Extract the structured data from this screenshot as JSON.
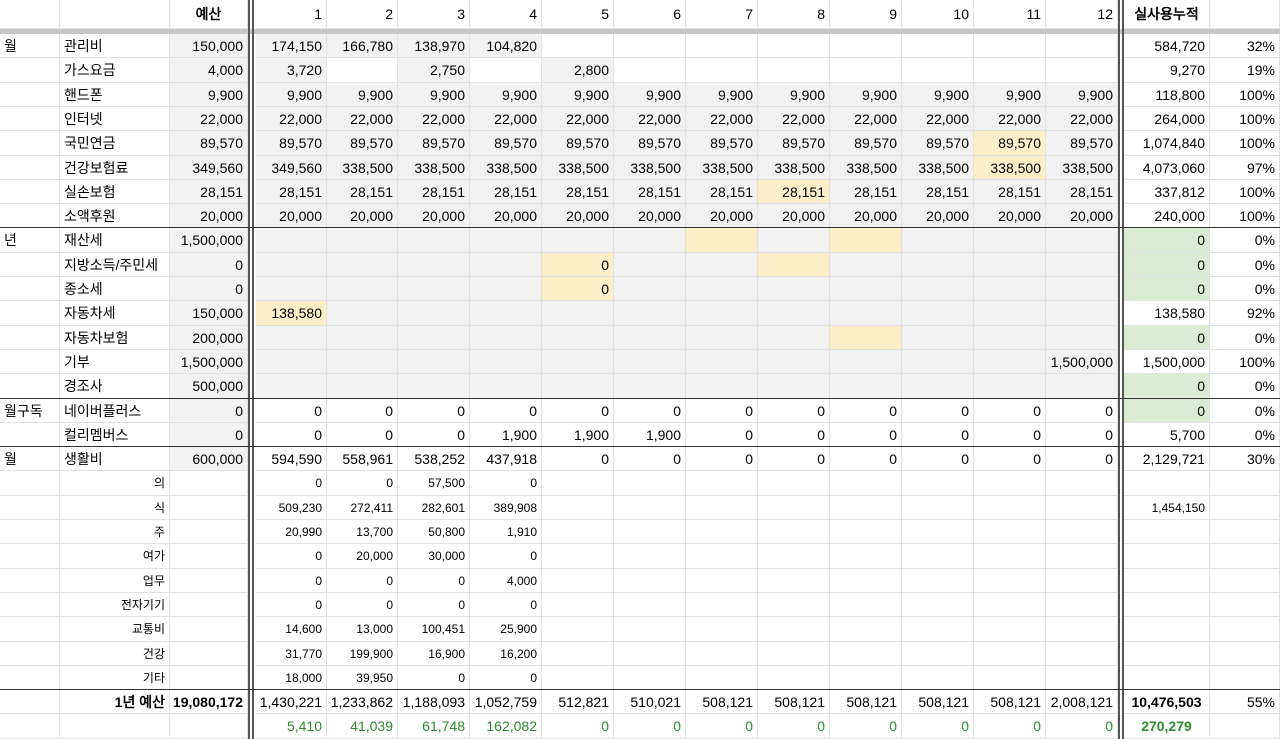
{
  "header": {
    "budget_label": "예산",
    "months": [
      "1",
      "2",
      "3",
      "4",
      "5",
      "6",
      "7",
      "8",
      "9",
      "10",
      "11",
      "12"
    ],
    "total_label": "실사용누적"
  },
  "groups": [
    "월",
    "년",
    "월구독",
    "월"
  ],
  "rows": [
    {
      "category": "월",
      "label": "관리비",
      "budget": "150,000",
      "months": [
        "174,150",
        "166,780",
        "138,970",
        "104,820",
        "",
        "",
        "",
        "",
        "",
        "",
        "",
        ""
      ],
      "total": "584,720",
      "pct": "32%"
    },
    {
      "category": "",
      "label": "가스요금",
      "budget": "4,000",
      "months": [
        "3,720",
        "",
        "2,750",
        "",
        "2,800",
        "",
        "",
        "",
        "",
        "",
        "",
        ""
      ],
      "total": "9,270",
      "pct": "19%"
    },
    {
      "category": "",
      "label": "핸드폰",
      "budget": "9,900",
      "months": [
        "9,900",
        "9,900",
        "9,900",
        "9,900",
        "9,900",
        "9,900",
        "9,900",
        "9,900",
        "9,900",
        "9,900",
        "9,900",
        "9,900"
      ],
      "total": "118,800",
      "pct": "100%"
    },
    {
      "category": "",
      "label": "인터넷",
      "budget": "22,000",
      "months": [
        "22,000",
        "22,000",
        "22,000",
        "22,000",
        "22,000",
        "22,000",
        "22,000",
        "22,000",
        "22,000",
        "22,000",
        "22,000",
        "22,000"
      ],
      "total": "264,000",
      "pct": "100%"
    },
    {
      "category": "",
      "label": "국민연금",
      "budget": "89,570",
      "months": [
        "89,570",
        "89,570",
        "89,570",
        "89,570",
        "89,570",
        "89,570",
        "89,570",
        "89,570",
        "89,570",
        "89,570",
        "89,570",
        "89,570"
      ],
      "total": "1,074,840",
      "pct": "100%"
    },
    {
      "category": "",
      "label": "건강보험료",
      "budget": "349,560",
      "months": [
        "349,560",
        "338,500",
        "338,500",
        "338,500",
        "338,500",
        "338,500",
        "338,500",
        "338,500",
        "338,500",
        "338,500",
        "338,500",
        "338,500"
      ],
      "total": "4,073,060",
      "pct": "97%"
    },
    {
      "category": "",
      "label": "실손보험",
      "budget": "28,151",
      "months": [
        "28,151",
        "28,151",
        "28,151",
        "28,151",
        "28,151",
        "28,151",
        "28,151",
        "28,151",
        "28,151",
        "28,151",
        "28,151",
        "28,151"
      ],
      "total": "337,812",
      "pct": "100%"
    },
    {
      "category": "",
      "label": "소액후원",
      "budget": "20,000",
      "months": [
        "20,000",
        "20,000",
        "20,000",
        "20,000",
        "20,000",
        "20,000",
        "20,000",
        "20,000",
        "20,000",
        "20,000",
        "20,000",
        "20,000"
      ],
      "total": "240,000",
      "pct": "100%"
    },
    {
      "category": "년",
      "label": "재산세",
      "budget": "1,500,000",
      "months": [
        "",
        "",
        "",
        "",
        "",
        "",
        "",
        "",
        "",
        "",
        "",
        ""
      ],
      "total": "0",
      "pct": "0%"
    },
    {
      "category": "",
      "label": "지방소득/주민세",
      "budget": "0",
      "months": [
        "",
        "",
        "",
        "",
        "0",
        "",
        "",
        "",
        "",
        "",
        "",
        ""
      ],
      "total": "0",
      "pct": "0%"
    },
    {
      "category": "",
      "label": "종소세",
      "budget": "0",
      "months": [
        "",
        "",
        "",
        "",
        "0",
        "",
        "",
        "",
        "",
        "",
        "",
        ""
      ],
      "total": "0",
      "pct": "0%"
    },
    {
      "category": "",
      "label": "자동차세",
      "budget": "150,000",
      "months": [
        "138,580",
        "",
        "",
        "",
        "",
        "",
        "",
        "",
        "",
        "",
        "",
        ""
      ],
      "total": "138,580",
      "pct": "92%"
    },
    {
      "category": "",
      "label": "자동차보험",
      "budget": "200,000",
      "months": [
        "",
        "",
        "",
        "",
        "",
        "",
        "",
        "",
        "",
        "",
        "",
        ""
      ],
      "total": "0",
      "pct": "0%"
    },
    {
      "category": "",
      "label": "기부",
      "budget": "1,500,000",
      "months": [
        "",
        "",
        "",
        "",
        "",
        "",
        "",
        "",
        "",
        "",
        "",
        "1,500,000"
      ],
      "total": "1,500,000",
      "pct": "100%"
    },
    {
      "category": "",
      "label": "경조사",
      "budget": "500,000",
      "months": [
        "",
        "",
        "",
        "",
        "",
        "",
        "",
        "",
        "",
        "",
        "",
        ""
      ],
      "total": "0",
      "pct": "0%"
    },
    {
      "category": "월구독",
      "label": "네이버플러스",
      "budget": "0",
      "months": [
        "0",
        "0",
        "0",
        "0",
        "0",
        "0",
        "0",
        "0",
        "0",
        "0",
        "0",
        "0"
      ],
      "total": "0",
      "pct": "0%"
    },
    {
      "category": "",
      "label": "컬리멤버스",
      "budget": "0",
      "months": [
        "0",
        "0",
        "0",
        "1,900",
        "1,900",
        "1,900",
        "0",
        "0",
        "0",
        "0",
        "0",
        "0"
      ],
      "total": "5,700",
      "pct": "0%"
    },
    {
      "category": "월",
      "label": "생활비",
      "budget": "600,000",
      "months": [
        "594,590",
        "558,961",
        "538,252",
        "437,918",
        "0",
        "0",
        "0",
        "0",
        "0",
        "0",
        "0",
        "0"
      ],
      "total": "2,129,721",
      "pct": "30%"
    },
    {
      "category": "",
      "label": "의",
      "budget": "",
      "months": [
        "0",
        "0",
        "57,500",
        "0",
        "",
        "",
        "",
        "",
        "",
        "",
        "",
        ""
      ],
      "total": "",
      "pct": ""
    },
    {
      "category": "",
      "label": "식",
      "budget": "",
      "months": [
        "509,230",
        "272,411",
        "282,601",
        "389,908",
        "",
        "",
        "",
        "",
        "",
        "",
        "",
        ""
      ],
      "total": "1,454,150",
      "pct": ""
    },
    {
      "category": "",
      "label": "주",
      "budget": "",
      "months": [
        "20,990",
        "13,700",
        "50,800",
        "1,910",
        "",
        "",
        "",
        "",
        "",
        "",
        "",
        ""
      ],
      "total": "",
      "pct": ""
    },
    {
      "category": "",
      "label": "여가",
      "budget": "",
      "months": [
        "0",
        "20,000",
        "30,000",
        "0",
        "",
        "",
        "",
        "",
        "",
        "",
        "",
        ""
      ],
      "total": "",
      "pct": ""
    },
    {
      "category": "",
      "label": "업무",
      "budget": "",
      "months": [
        "0",
        "0",
        "0",
        "4,000",
        "",
        "",
        "",
        "",
        "",
        "",
        "",
        ""
      ],
      "total": "",
      "pct": ""
    },
    {
      "category": "",
      "label": "전자기기",
      "budget": "",
      "months": [
        "0",
        "0",
        "0",
        "0",
        "",
        "",
        "",
        "",
        "",
        "",
        "",
        ""
      ],
      "total": "",
      "pct": ""
    },
    {
      "category": "",
      "label": "교통비",
      "budget": "",
      "months": [
        "14,600",
        "13,000",
        "100,451",
        "25,900",
        "",
        "",
        "",
        "",
        "",
        "",
        "",
        ""
      ],
      "total": "",
      "pct": ""
    },
    {
      "category": "",
      "label": "건강",
      "budget": "",
      "months": [
        "31,770",
        "199,900",
        "16,900",
        "16,200",
        "",
        "",
        "",
        "",
        "",
        "",
        "",
        ""
      ],
      "total": "",
      "pct": ""
    },
    {
      "category": "",
      "label": "기타",
      "budget": "",
      "months": [
        "18,000",
        "39,950",
        "0",
        "0",
        "",
        "",
        "",
        "",
        "",
        "",
        "",
        ""
      ],
      "total": "",
      "pct": ""
    },
    {
      "category": "",
      "label": "1년 예산",
      "budget": "19,080,172",
      "months": [
        "1,430,221",
        "1,233,862",
        "1,188,093",
        "1,052,759",
        "512,821",
        "510,021",
        "508,121",
        "508,121",
        "508,121",
        "508,121",
        "508,121",
        "2,008,121"
      ],
      "total": "10,476,503",
      "pct": "55%"
    },
    {
      "category": "",
      "label": "",
      "budget": "",
      "months": [
        "5,410",
        "41,039",
        "61,748",
        "162,082",
        "0",
        "0",
        "0",
        "0",
        "0",
        "0",
        "0",
        "0"
      ],
      "total": "270,279",
      "pct": ""
    }
  ],
  "colors": {
    "gray_fill": "#f2f2f2",
    "yellow_fill": "#fdf0c9",
    "green_fill": "#dcebd3",
    "green_text": "#2e8b2e"
  }
}
